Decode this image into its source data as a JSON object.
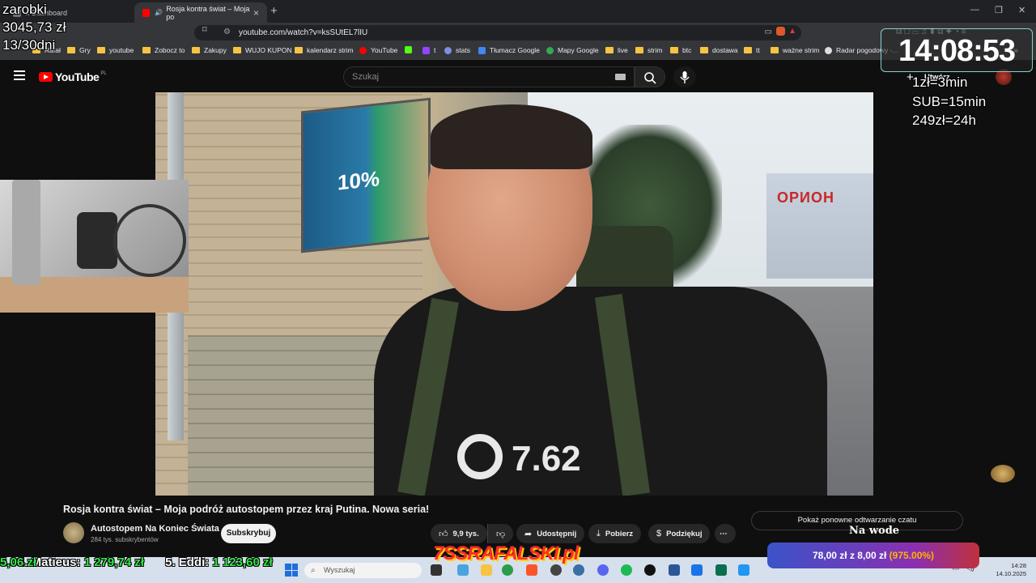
{
  "browser": {
    "tabs": [
      {
        "label": "k Dashboard",
        "active": false
      },
      {
        "label": "Rosja kontra świat – Moja po",
        "active": true
      }
    ],
    "url": "youtube.com/watch?v=ksSUtEL7lIU",
    "bookmarks": [
      "Rafał",
      "Gry",
      "youtube",
      "Zobocz to",
      "Zakupy",
      "WUJO KUPON",
      "kalendarz strim",
      "YouTube",
      "t",
      "stats",
      "Tłumacz Google",
      "Mapy Google",
      "live",
      "strim",
      "btc",
      "dostawa",
      "tt",
      "ważne strim",
      "Radar pogodowy -..."
    ]
  },
  "youtube": {
    "logo": "YouTube",
    "region": "PL",
    "search_placeholder": "Szukaj",
    "create_label": "Utwórz",
    "video_title": "Rosja kontra świat – Moja podróż autostopem przez kraj Putina. Nowa seria!",
    "channel_name": "Autostopem Na Koniec Świata",
    "channel_subs": "284 tys. subskrybentów",
    "subscribe_label": "Subskrybuj",
    "likes": "9,9 tys.",
    "share_label": "Udostępnij",
    "download_label": "Pobierz",
    "thanks_label": "Podziękuj",
    "chat_replay_label": "Pokaż ponowne odtwarzanie czatu"
  },
  "video_content": {
    "shirt_logo": "7.62",
    "billboard_percent": "10%",
    "store_sign": "ОРИОН"
  },
  "stream_overlay": {
    "earnings_label": "zarobki",
    "earnings_value": "3045,73 zł",
    "days": "13/30dni",
    "clock": "14:08:53",
    "rates": [
      "1zł=3min",
      "SUB=15min",
      "249zł=24h"
    ],
    "ticker": [
      {
        "text": "5,06 zł",
        "highlight": true
      },
      {
        "text": "4. Matieus: ",
        "highlight": false
      },
      {
        "text": "1 279,74 zł",
        "highlight": true
      },
      {
        "text": "5. Eddi: ",
        "highlight": false
      },
      {
        "text": "1 123,60 zł",
        "highlight": true
      }
    ],
    "brand": "7SSRAFALSKI.pl",
    "na_wode": "Na wode",
    "donation_text": "78,00 zł z 8,00 zł",
    "donation_pct": "(975.00%)"
  },
  "taskbar": {
    "search_placeholder": "Wyszukaj",
    "time": "14:28",
    "date": "14.10.2025"
  }
}
